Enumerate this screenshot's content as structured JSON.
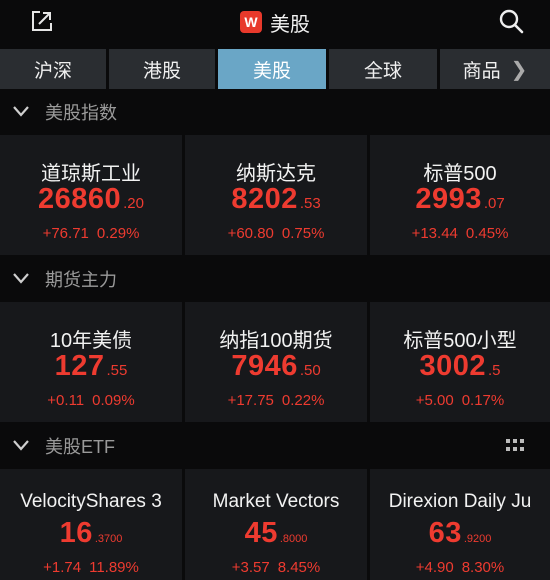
{
  "header": {
    "logo_text": "W",
    "title": "美股"
  },
  "tabs": [
    {
      "label": "沪深"
    },
    {
      "label": "港股"
    },
    {
      "label": "美股"
    },
    {
      "label": "全球"
    },
    {
      "label": "商品"
    }
  ],
  "sections": [
    {
      "title": "美股指数",
      "cards": [
        {
          "name": "道琼斯工业",
          "price_int": "26860",
          "price_dec": ".20",
          "change": "+76.71",
          "change_pct": "0.29%"
        },
        {
          "name": "纳斯达克",
          "price_int": "8202",
          "price_dec": ".53",
          "change": "+60.80",
          "change_pct": "0.75%"
        },
        {
          "name": "标普500",
          "price_int": "2993",
          "price_dec": ".07",
          "change": "+13.44",
          "change_pct": "0.45%"
        }
      ]
    },
    {
      "title": "期货主力",
      "cards": [
        {
          "name": "10年美债",
          "price_int": "127",
          "price_dec": ".55",
          "change": "+0.11",
          "change_pct": "0.09%"
        },
        {
          "name": "纳指100期货",
          "price_int": "7946",
          "price_dec": ".50",
          "change": "+17.75",
          "change_pct": "0.22%"
        },
        {
          "name": "标普500小型",
          "price_int": "3002",
          "price_dec": ".5",
          "change": "+5.00",
          "change_pct": "0.17%"
        }
      ]
    },
    {
      "title": "美股ETF",
      "cards": [
        {
          "name": "VelocityShares 3",
          "price_int": "16",
          "price_dec": ".3700",
          "change": "+1.74",
          "change_pct": "11.89%"
        },
        {
          "name": "Market Vectors",
          "price_int": "45",
          "price_dec": ".8000",
          "change": "+3.57",
          "change_pct": "8.45%"
        },
        {
          "name": "Direxion Daily Ju",
          "price_int": "63",
          "price_dec": ".9200",
          "change": "+4.90",
          "change_pct": "8.30%"
        }
      ]
    }
  ],
  "colors": {
    "up": "#ee3b30",
    "tab_active": "#6aa6c6",
    "card_bg": "#17181b"
  },
  "icons": {
    "share": "share-icon",
    "search": "search-icon",
    "collapse": "chevron-down-icon",
    "more": "chevron-right-icon",
    "grid": "grid-icon"
  }
}
